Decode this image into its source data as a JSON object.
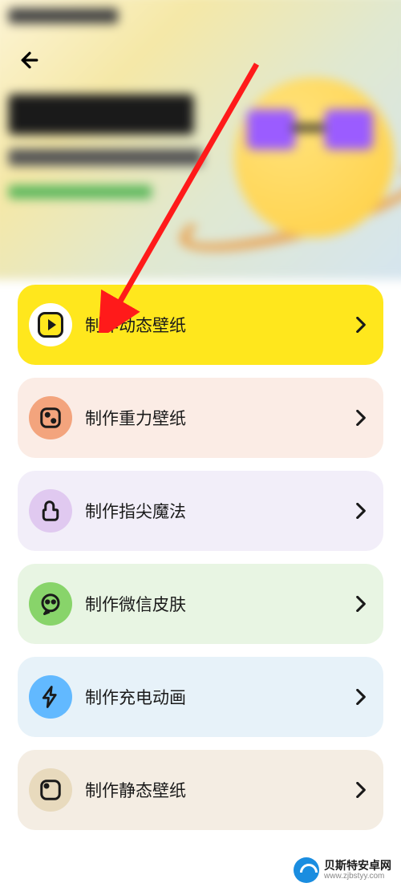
{
  "items": [
    {
      "label": "制作动态壁纸",
      "color": "yellow",
      "icon": "play-icon"
    },
    {
      "label": "制作重力壁纸",
      "color": "orange",
      "icon": "dice-icon"
    },
    {
      "label": "制作指尖魔法",
      "color": "purple",
      "icon": "thumb-icon"
    },
    {
      "label": "制作微信皮肤",
      "color": "green",
      "icon": "chat-icon"
    },
    {
      "label": "制作充电动画",
      "color": "blue",
      "icon": "bolt-icon"
    },
    {
      "label": "制作静态壁纸",
      "color": "tan",
      "icon": "frame-icon"
    }
  ],
  "watermark": {
    "title": "贝斯特安卓网",
    "url": "www.zjbstyy.com"
  },
  "annotation": "arrow-pointing-to-first-item"
}
